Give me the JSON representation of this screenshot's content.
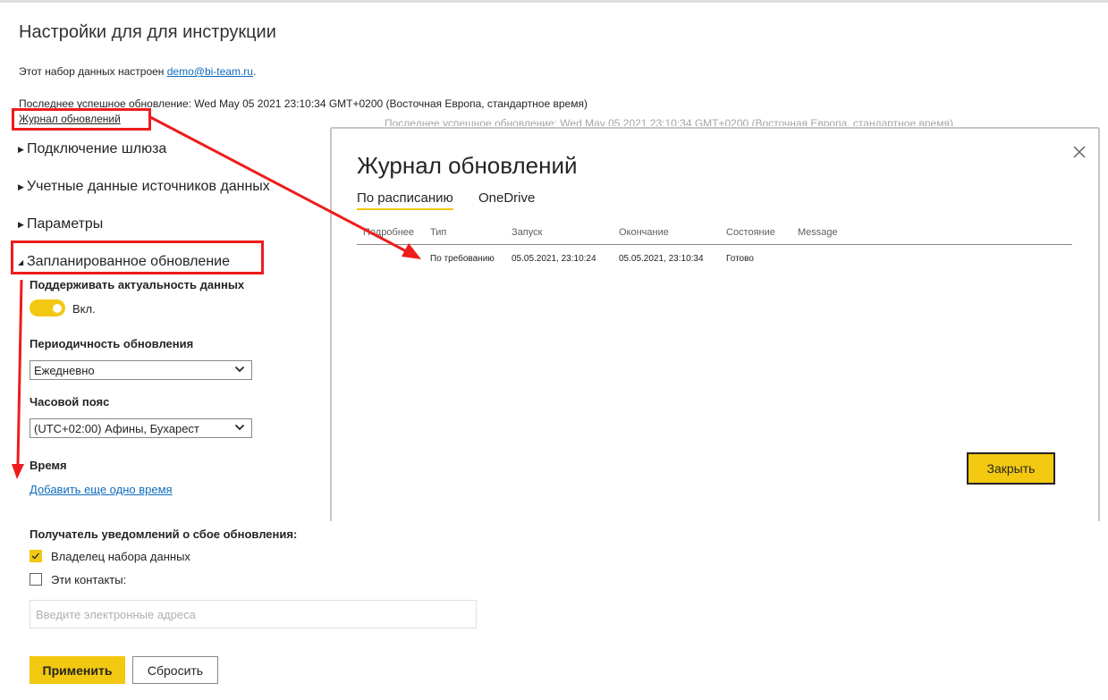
{
  "page": {
    "title": "Настройки для для инструкции",
    "owner_prefix": "Этот набор данных настроен ",
    "owner_email": "demo@bi-team.ru",
    "owner_suffix": ".",
    "last_refresh": "Последнее успешное обновление: Wed May 05 2021 23:10:34 GMT+0200 (Восточная Европа, стандартное время)",
    "history_link": "Журнал обновлений",
    "ghost_text": "Последнее успешное обновление: Wed May 05 2021 23:10:34 GMT+0200 (Восточная Европа, стандартное время)"
  },
  "sections": {
    "gateway": "Подключение шлюза",
    "credentials": "Учетные данные источников данных",
    "parameters": "Параметры",
    "scheduled": "Запланированное обновление"
  },
  "schedule": {
    "keep_uptodate_label": "Поддерживать актуальность данных",
    "toggle_state": "Вкл.",
    "toggle_on": true,
    "frequency_label": "Периодичность обновления",
    "frequency_value": "Ежедневно",
    "timezone_label": "Часовой пояс",
    "timezone_value": "(UTC+02:00) Афины, Бухарест",
    "time_label": "Время",
    "add_time_link": "Добавить еще одно время"
  },
  "notifications": {
    "label": "Получатель уведомлений о сбое обновления:",
    "owner_label": "Владелец набора данных",
    "owner_checked": true,
    "contacts_label": "Эти контакты:",
    "contacts_checked": false,
    "email_placeholder": "Введите электронные адреса"
  },
  "actions": {
    "apply": "Применить",
    "reset": "Сбросить"
  },
  "dialog": {
    "title": "Журнал обновлений",
    "tabs": [
      "По расписанию",
      "OneDrive"
    ],
    "active_tab": "По расписанию",
    "columns": [
      "Подробнее",
      "Тип",
      "Запуск",
      "Окончание",
      "Состояние",
      "Message"
    ],
    "rows": [
      {
        "details": "",
        "type": "По требованию",
        "start": "05.05.2021, 23:10:24",
        "end": "05.05.2021, 23:10:34",
        "status": "Готово",
        "message": ""
      }
    ],
    "close_button": "Закрыть"
  },
  "colors": {
    "accent": "#f2c811",
    "annotation": "#ee1c1c",
    "link": "#0f6cbd"
  },
  "icons": [
    "caret-right-icon",
    "caret-down-icon",
    "chevron-down-icon",
    "check-icon",
    "close-icon"
  ]
}
